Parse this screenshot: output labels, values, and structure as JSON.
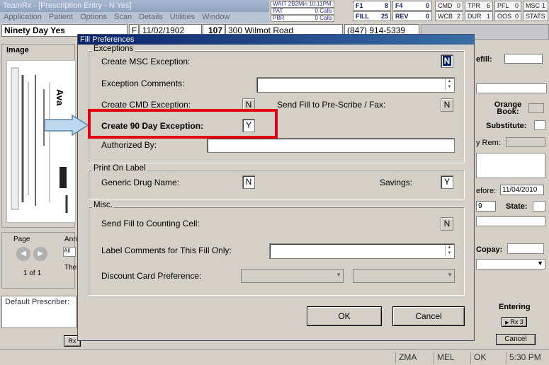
{
  "app": {
    "title": "TeamRx - [Prescription Entry - N Yes]",
    "menu": [
      "Application",
      "Patient",
      "Options",
      "Scan",
      "Details",
      "Utilities",
      "Window"
    ]
  },
  "status_mini": [
    {
      "label": "WAIT",
      "value": "2B2Min",
      "time": "10:11PM"
    },
    {
      "label": "PAT",
      "value": "0 Calls"
    },
    {
      "label": "PBR",
      "value": "0 Calls"
    }
  ],
  "counters": [
    {
      "label": "F1",
      "value": "8"
    },
    {
      "label": "F4",
      "value": "0"
    },
    {
      "label": "FILL",
      "value": "25"
    },
    {
      "label": "REV",
      "value": "0"
    }
  ],
  "counters2": [
    {
      "label": "CMD",
      "value": "0"
    },
    {
      "label": "TPR",
      "value": "6"
    },
    {
      "label": "PFL",
      "value": "0"
    },
    {
      "label": "MSC",
      "value": "1"
    },
    {
      "label": "WCB",
      "value": "2"
    },
    {
      "label": "DUR",
      "value": "1"
    },
    {
      "label": "OOS",
      "value": "0"
    },
    {
      "label": "STATS",
      "value": ""
    }
  ],
  "patient": {
    "name": "Ninety Day Yes",
    "gender": "F",
    "dob": "11/02/1902",
    "house": "107",
    "address": "300 Wilmot Road",
    "phone": "(847) 914-5339"
  },
  "left_panel": {
    "image_label": "Image",
    "doc_text": "Ava",
    "page_label": "Page",
    "page_count": "1 of 1",
    "ann_label": "Ann",
    "all_label": "All",
    "ther_label": "Ther",
    "default_prescriber": "Default Prescriber:",
    "rx_button": "Rx"
  },
  "dialog": {
    "title": "Fill Preferences",
    "exceptions": {
      "title": "Exceptions",
      "msc_label": "Create MSC Exception:",
      "msc_value": "N",
      "comments_label": "Exception Comments:",
      "cmd_label": "Create CMD Exception:",
      "cmd_value": "N",
      "prescribe_label": "Send Fill to Pre-Scribe / Fax:",
      "prescribe_value": "N",
      "ninety_label": "Create 90 Day Exception:",
      "ninety_value": "Y",
      "authorized_label": "Authorized By:"
    },
    "print_on_label": {
      "title": "Print On Label",
      "generic_label": "Generic Drug Name:",
      "generic_value": "N",
      "savings_label": "Savings:",
      "savings_value": "Y"
    },
    "misc": {
      "title": "Misc.",
      "counting_label": "Send Fill to Counting Cell:",
      "counting_value": "N",
      "label_comments_label": "Label Comments for This Fill Only:",
      "discount_label": "Discount Card Preference:"
    },
    "ok_label": "OK",
    "cancel_label": "Cancel"
  },
  "right_panel": {
    "refill_label": "efill:",
    "orange_book_label": "Orange Book:",
    "substitute_label": "Substitute:",
    "rem_label": "y Rem:",
    "before_label": "efore:",
    "before_value": "11/04/2010",
    "zip_partial": "9",
    "state_label": "State:",
    "copay_label": "Copay:",
    "entering_label": "Entering",
    "rx_label": "Rx 3",
    "cancel_label": "Cancel"
  },
  "statusbar": {
    "c1": "ZMA",
    "c2": "MEL",
    "c3": "OK",
    "time": "5:30 PM"
  },
  "colors": {
    "highlight": "#e00010",
    "arrow_fill": "#bcd8ee",
    "dialog_title": "#0a246a"
  }
}
